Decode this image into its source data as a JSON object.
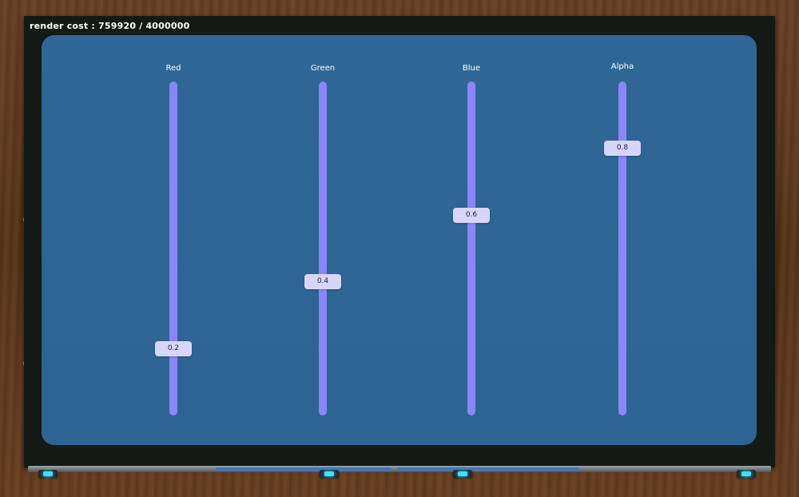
{
  "header": {
    "render_cost": "render cost : 759920 / 4000000"
  },
  "sliders": [
    {
      "label": "Red",
      "value": "0.2",
      "level": 0.2
    },
    {
      "label": "Green",
      "value": "0.4",
      "level": 0.4
    },
    {
      "label": "Blue",
      "value": "0.6",
      "level": 0.6
    },
    {
      "label": "Alpha",
      "value": "0.8",
      "level": 0.8
    }
  ],
  "colors": {
    "screen_bg": "#2f6796",
    "track": "#8a86f8",
    "thumb": "#d8d5fb",
    "frame": "#141a16",
    "indicator_light": "#3fe0ff"
  }
}
